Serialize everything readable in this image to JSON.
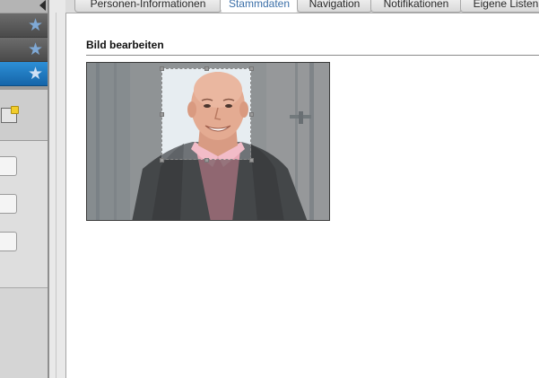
{
  "tabs": [
    "Personen-Informationen",
    "Stammdaten",
    "Navigation",
    "Notifikationen",
    "Eigene Listen"
  ],
  "active_tab": "Stammdaten",
  "section_title": "Bild bearbeiten",
  "sidebar": {
    "collapse_icon": "triangle-left-icon",
    "favorite_icon": "star-icon",
    "add_icon": "add-folder-icon"
  }
}
